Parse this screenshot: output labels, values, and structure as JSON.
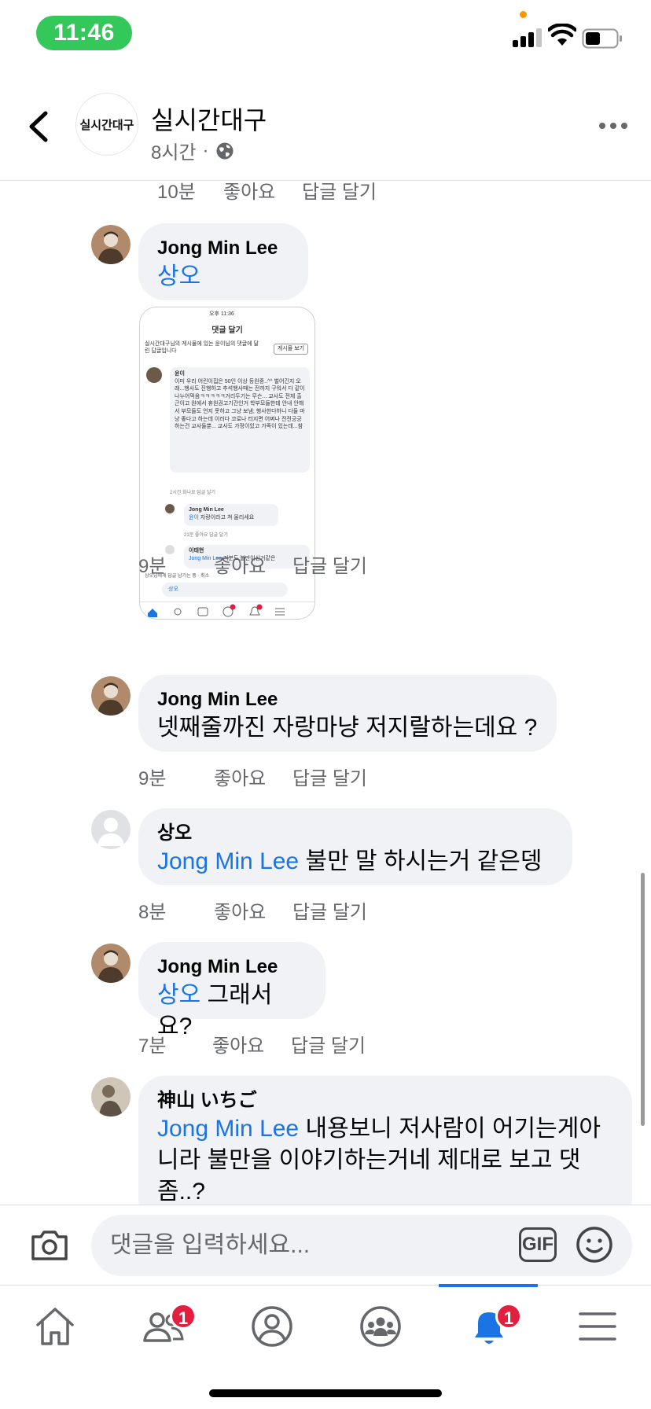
{
  "status_bar": {
    "time": "11:46"
  },
  "header": {
    "page_name": "실시간대구",
    "avatar_text": "실시간대구",
    "time": "8시간",
    "separator": "·"
  },
  "labels": {
    "like": "좋아요",
    "reply": "답글 달기"
  },
  "top_meta": {
    "time": "10분"
  },
  "comments": [
    {
      "author": "Jong Min Lee",
      "mention": "상오",
      "text": "",
      "time": "9분",
      "attachment": {
        "time": "오후 11:36",
        "title": "댓글 달기",
        "context": "실시간대구님의 게시물에 있는 윤이님의 댓글에 달린 답글입니다",
        "post_button": "게시물 보기",
        "c1_author": "윤이",
        "c1_text": "이미 우리 어린이집은 50인 이상 등원중..^^ 벌어긴지 오래...행사도 진행하고 추석행사때는 전까지 구워서 다 같이 나누어먹음ㅋㅋㅋㅋㅋ거리두기는 무슨... 교사도 전체 출근이고 원에서 휴원권고기간인거 학부모들한테 안내 안해서 부모들도 언지 못하고 그냥 보냄; 행사한다하니 다들 마냥 좋다고 하는데 이러다 코로나 터지면 어쩌나 전전긍긍하는건 교사들뿐... 교사도 가정이있고 가족이 있는데...참",
        "c1_meta": "2시간  화나요  답글 달기",
        "c2_author": "Jong Min Lee",
        "c2_mention": "윤이",
        "c2_text": "자랑이라고 쳐 올리세요",
        "c2_meta": "21분  좋아요  답글 달기",
        "c3_author": "이태현",
        "c3_mention": "Jong Min Lee",
        "c3_text": "저분도 불만이신거같은",
        "replying": "상오님에게 답글 남기는 중 · 취소",
        "input": "상오"
      }
    },
    {
      "author": "Jong Min Lee",
      "mention": "",
      "text": "넷째줄까진 자랑마냥 저지랄하는데요 ?",
      "time": "9분"
    },
    {
      "author": "상오",
      "mention": "Jong Min Lee",
      "text": "불만 말 하시는거 같은뎅",
      "time": "8분"
    },
    {
      "author": "Jong Min Lee",
      "mention": "상오",
      "text": "그래서요?",
      "time": "7분"
    },
    {
      "author": "神山 いちご",
      "mention": "Jong Min Lee",
      "text_line1": "내용보니 저사람이 어기는게아",
      "text_line2": "니라 불만을 이야기하는거네 제대로 보고 댓",
      "text_line3": "좀..?"
    }
  ],
  "composer": {
    "placeholder": "댓글을 입력하세요...",
    "gif_label": "GIF"
  },
  "tabbar": {
    "friends_badge": "1",
    "notifications_badge": "1",
    "active_tab": "notifications"
  },
  "colors": {
    "accent": "#1b74e4",
    "badge": "#e41e3f",
    "bubble": "#f0f2f5",
    "meta": "#65676b"
  }
}
